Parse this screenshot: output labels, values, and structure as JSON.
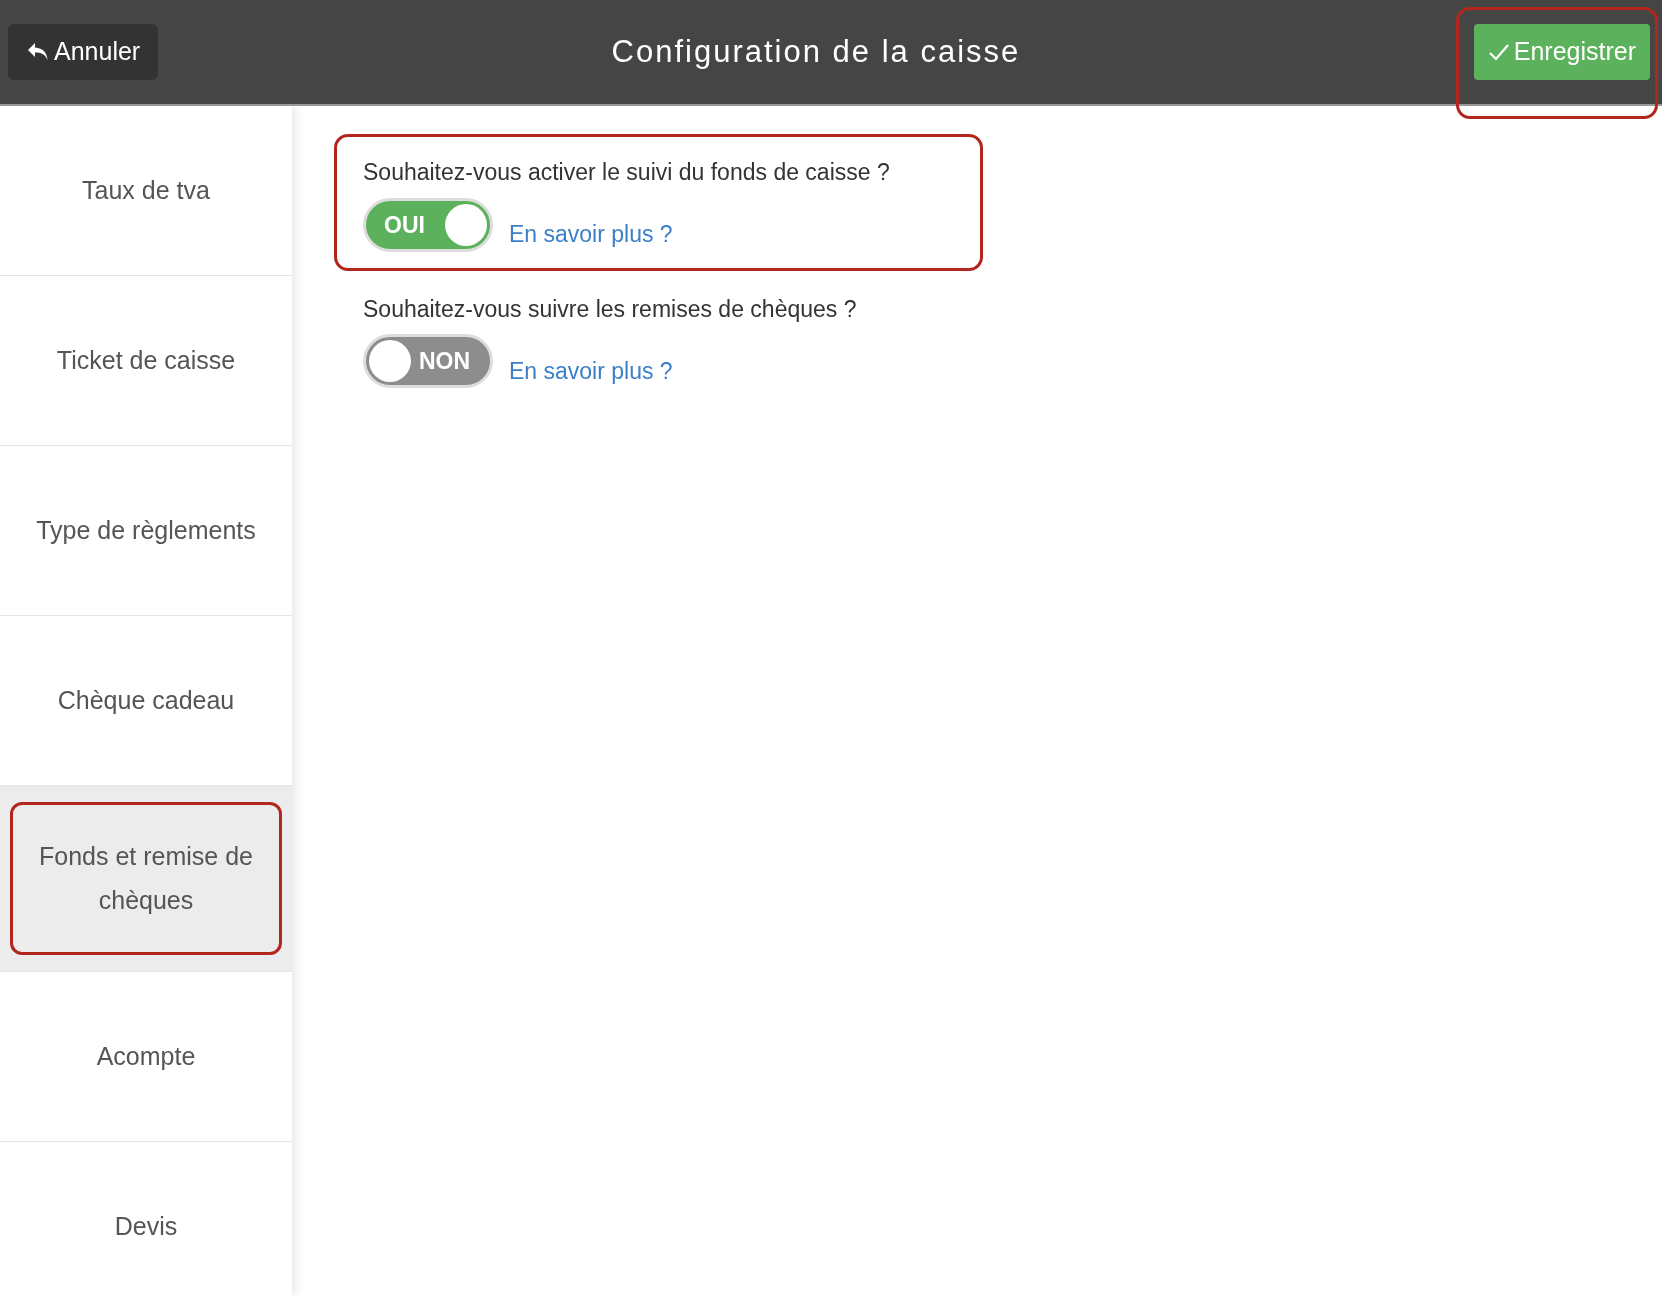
{
  "header": {
    "title": "Configuration de la caisse",
    "cancel_button": "Annuler",
    "save_button": {
      "label": "Enregistrer",
      "highlighted": true
    }
  },
  "sidebar": {
    "items": [
      {
        "label": "Taux de tva",
        "selected": false,
        "highlighted": false
      },
      {
        "label": "Ticket de caisse",
        "selected": false,
        "highlighted": false
      },
      {
        "label": "Type de règlements",
        "selected": false,
        "highlighted": false
      },
      {
        "label": "Chèque cadeau",
        "selected": false,
        "highlighted": false
      },
      {
        "label": "Fonds et remise de chèques",
        "selected": true,
        "highlighted": true
      },
      {
        "label": "Acompte",
        "selected": false,
        "highlighted": false
      },
      {
        "label": "Devis",
        "selected": false,
        "highlighted": false
      }
    ]
  },
  "settings": [
    {
      "question": "Souhaitez-vous activer le suivi du fonds de caisse ?",
      "on": true,
      "toggle_label": "OUI",
      "link": "En savoir plus ?",
      "highlighted": true
    },
    {
      "question": "Souhaitez-vous suivre les remises de chèques ?",
      "on": false,
      "toggle_label": "NON",
      "link": "En savoir plus ?",
      "highlighted": false
    }
  ]
}
